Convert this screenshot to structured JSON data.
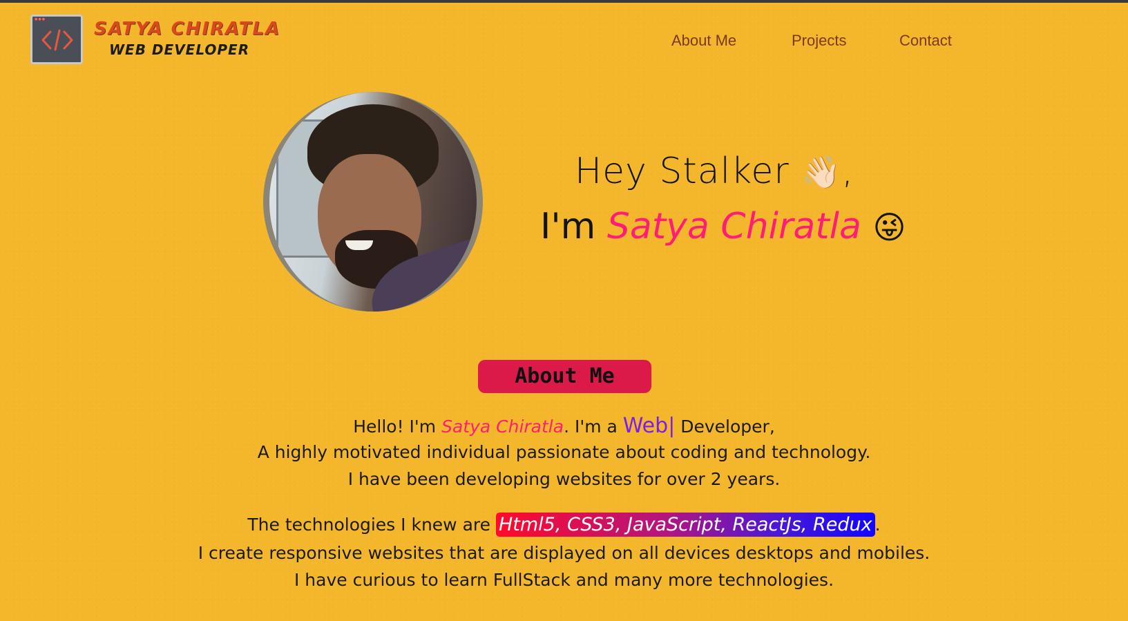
{
  "brand": {
    "name": "SATYA CHIRATLA",
    "role": "WEB DEVELOPER",
    "logo_icon": "code-icon",
    "logo_glyph": "</>"
  },
  "nav": {
    "items": [
      {
        "label": "About Me"
      },
      {
        "label": "Projects"
      },
      {
        "label": "Contact"
      }
    ]
  },
  "hero": {
    "greeting": "Hey Stalker",
    "greeting_emoji": "👋🏻",
    "greeting_suffix": ",",
    "intro_prefix": "I'm",
    "intro_name": "Satya Chiratla",
    "intro_emoji": "😜",
    "photo_alt": "profile-photo"
  },
  "about": {
    "heading": "About Me",
    "line1_prefix": "Hello! I'm ",
    "line1_name": "Satya Chiratla",
    "line1_middle": ". I'm a ",
    "line1_typed": "Web",
    "line1_cursor": "|",
    "line1_suffix": " Developer,",
    "line2": "A highly motivated individual passionate about coding and technology.",
    "line3": "I have been developing websites for over 2 years.",
    "line4_prefix": "The technologies I knew are ",
    "line4_tech": "Html5, CSS3, JavaScript, ReactJs, Redux",
    "line4_suffix": ".",
    "line5": "I create responsive websites that are displayed on all devices desktops and mobiles.",
    "line6": "I have curious to learn FullStack and many more technologies."
  },
  "colors": {
    "background": "#f4b72c",
    "accent_pink": "#ff1e76",
    "pill_red": "#dc1a4a",
    "nav_text": "#7a3a14",
    "typed_purple": "#7b1fe8"
  }
}
